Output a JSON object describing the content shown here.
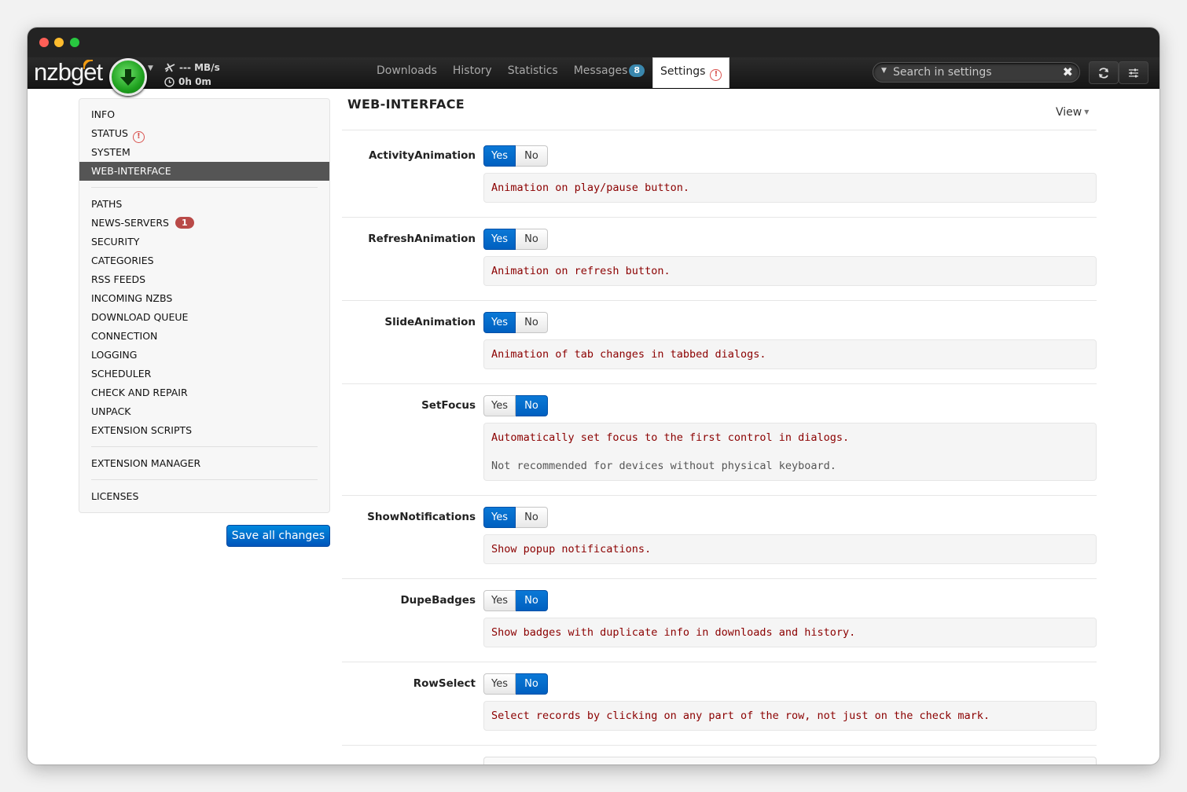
{
  "app": {
    "logo_text": "nzbget",
    "speed": "--- MB/s",
    "time_left": "0h 0m"
  },
  "tabs": [
    {
      "label": "Downloads"
    },
    {
      "label": "History"
    },
    {
      "label": "Statistics"
    },
    {
      "label": "Messages",
      "badge": "8"
    },
    {
      "label": "Settings",
      "active": true,
      "icon": "warning-circle-icon"
    }
  ],
  "search": {
    "placeholder": "Search in settings",
    "value": ""
  },
  "toolbar_icons": [
    "refresh-icon",
    "settings-sliders-icon"
  ],
  "sidebar": {
    "items": [
      {
        "label": "INFO"
      },
      {
        "label": "STATUS",
        "icon": "warning-circle-icon"
      },
      {
        "label": "SYSTEM"
      },
      {
        "label": "WEB-INTERFACE",
        "active": true
      },
      {
        "label": "PATHS"
      },
      {
        "label": "NEWS-SERVERS",
        "badge": "1"
      },
      {
        "label": "SECURITY"
      },
      {
        "label": "CATEGORIES"
      },
      {
        "label": "RSS FEEDS"
      },
      {
        "label": "INCOMING NZBS"
      },
      {
        "label": "DOWNLOAD QUEUE"
      },
      {
        "label": "CONNECTION"
      },
      {
        "label": "LOGGING"
      },
      {
        "label": "SCHEDULER"
      },
      {
        "label": "CHECK AND REPAIR"
      },
      {
        "label": "UNPACK"
      },
      {
        "label": "EXTENSION SCRIPTS"
      },
      {
        "label": "EXTENSION MANAGER"
      },
      {
        "label": "LICENSES"
      }
    ],
    "save_label": "Save all changes"
  },
  "main": {
    "title": "WEB-INTERFACE",
    "view_label": "View",
    "yes_label": "Yes",
    "no_label": "No",
    "options": [
      {
        "name": "ActivityAnimation",
        "value": "Yes",
        "desc": "Animation on play/pause button."
      },
      {
        "name": "RefreshAnimation",
        "value": "Yes",
        "desc": "Animation on refresh button."
      },
      {
        "name": "SlideAnimation",
        "value": "Yes",
        "desc": "Animation of tab changes in tabbed dialogs."
      },
      {
        "name": "SetFocus",
        "value": "No",
        "desc": "Automatically set focus to the first control in dialogs.",
        "note": "Not recommended for devices without physical keyboard."
      },
      {
        "name": "ShowNotifications",
        "value": "Yes",
        "desc": "Show popup notifications."
      },
      {
        "name": "DupeBadges",
        "value": "No",
        "desc": "Show badges with duplicate info in downloads and history."
      },
      {
        "name": "RowSelect",
        "value": "No",
        "desc": "Select records by clicking on any part of the row, not just on the check mark."
      }
    ]
  },
  "colors": {
    "accent": "#0066cc",
    "description_text": "#8b0000",
    "error": "#d9534f",
    "badge_red": "#b94a48",
    "badge_blue": "#3a87ad"
  }
}
